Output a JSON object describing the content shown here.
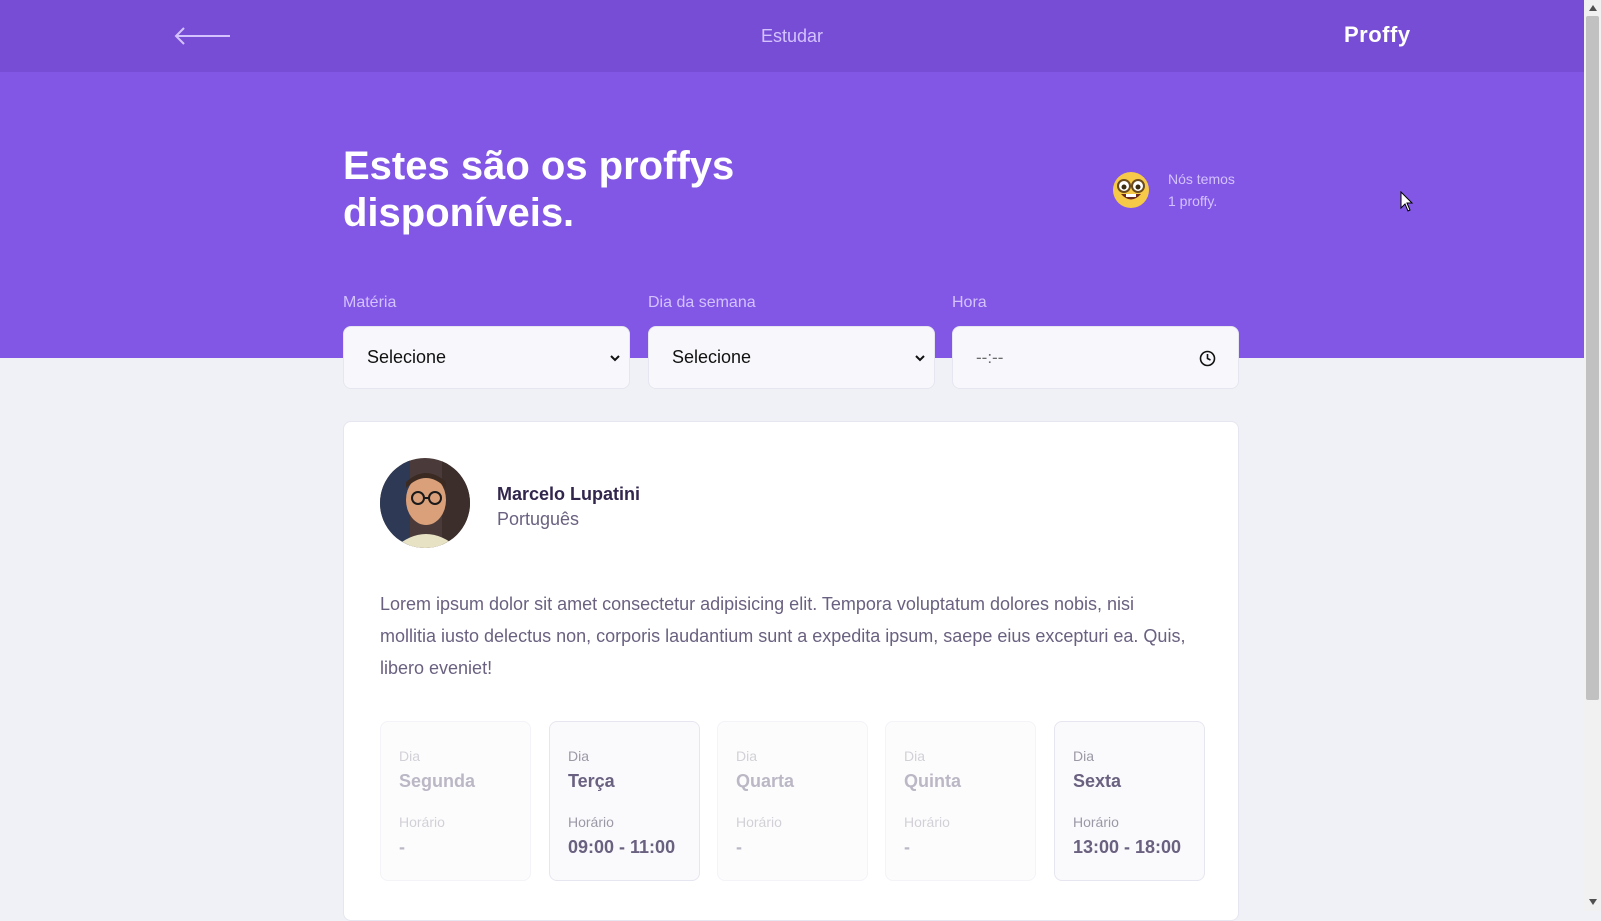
{
  "topbar": {
    "back_icon": "arrow-left-icon",
    "page_name": "Estudar",
    "logo": "Proffy"
  },
  "hero": {
    "title": "Estes são os proffys disponíveis.",
    "count_icon": "nerd-face-emoji-icon",
    "count_line1": "Nós temos",
    "count_line2": "1 proffy."
  },
  "filters": {
    "subject": {
      "label": "Matéria",
      "value": "Selecione"
    },
    "weekday": {
      "label": "Dia da semana",
      "value": "Selecione"
    },
    "time": {
      "label": "Hora",
      "value": "--:--"
    }
  },
  "teacher": {
    "name": "Marcelo Lupatini",
    "subject": "Português",
    "bio": "Lorem ipsum dolor sit amet consectetur adipisicing elit. Tempora voluptatum dolores nobis, nisi mollitia iusto delectus non, corporis laudantium sunt a expedita ipsum, saepe eius excepturi ea. Quis, libero eveniet!",
    "schedule": [
      {
        "day_label": "Dia",
        "day": "Segunda",
        "time_label": "Horário",
        "time": "-",
        "available": false
      },
      {
        "day_label": "Dia",
        "day": "Terça",
        "time_label": "Horário",
        "time": "09:00 - 11:00",
        "available": true
      },
      {
        "day_label": "Dia",
        "day": "Quarta",
        "time_label": "Horário",
        "time": "-",
        "available": false
      },
      {
        "day_label": "Dia",
        "day": "Quinta",
        "time_label": "Horário",
        "time": "-",
        "available": false
      },
      {
        "day_label": "Dia",
        "day": "Sexta",
        "time_label": "Horário",
        "time": "13:00 - 18:00",
        "available": true
      }
    ]
  },
  "colors": {
    "primary": "#8257e5",
    "primary_dark": "#774dd6",
    "background": "#f0f0f7",
    "text_title": "#32264d",
    "text_base": "#6a6180"
  }
}
